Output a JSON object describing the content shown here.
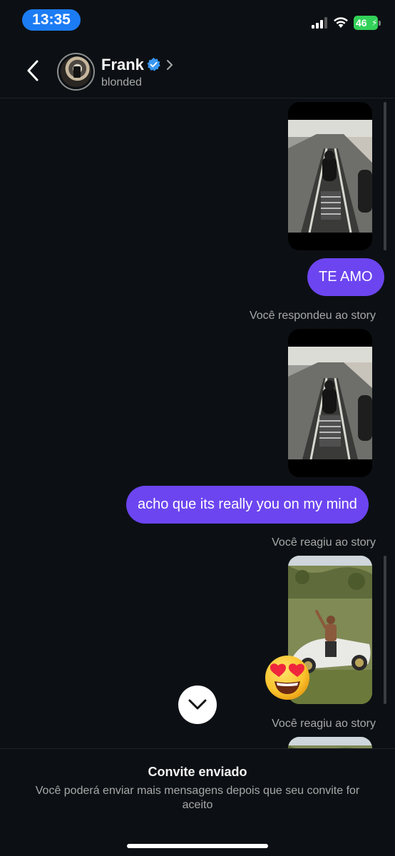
{
  "status_bar": {
    "time": "13:35",
    "battery": "46"
  },
  "header": {
    "name": "Frank",
    "username": "blonded"
  },
  "messages": {
    "bubble_1": "TE AMO",
    "label_1": "Você respondeu ao story",
    "bubble_2": "acho que its really you on my mind",
    "label_2": "Você reagiu ao story",
    "label_3": "Você reagiu ao story",
    "reaction": "😍"
  },
  "footer": {
    "title": "Convite enviado",
    "text": "Você poderá enviar mais mensagens depois que seu convite for aceito"
  },
  "colors": {
    "accent": "#6c45f0",
    "verified": "#3897f0",
    "time_pill": "#1c7cf4",
    "battery": "#32d158"
  }
}
